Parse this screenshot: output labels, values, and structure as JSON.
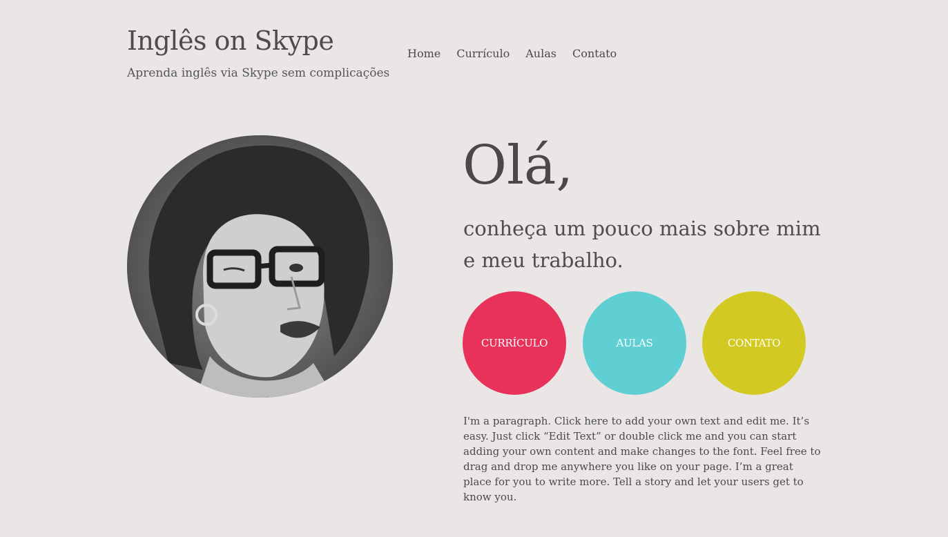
{
  "header": {
    "title": "Inglês on Skype",
    "subtitle": "Aprenda inglês via Skype sem complicações"
  },
  "nav": {
    "items": [
      "Home",
      "Currículo",
      "Aulas",
      "Contato"
    ]
  },
  "hero": {
    "greeting": "Olá,",
    "intro_line1": "conheça um pouco mais sobre mim",
    "intro_line2": "e meu trabalho."
  },
  "buttons": {
    "curriculo": "CURRÍCULO",
    "aulas": "AULAS",
    "contato": "CONTATO"
  },
  "paragraph": "I'm a paragraph. Click here to add your own text and edit me. It’s easy. Just click “Edit Text” or double click me and you can start adding your own content and make changes to the font. Feel free to drag and drop me anywhere you like on your page. I’m a great place for you to write more. Tell a story and let your users get to know you.",
  "colors": {
    "background": "#e9e6e5",
    "curriculo": "#e8325a",
    "aulas": "#5fcfd4",
    "contato": "#d2ca23"
  }
}
